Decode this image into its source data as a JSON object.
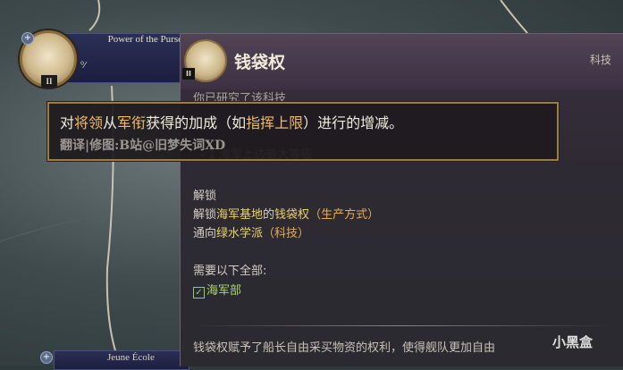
{
  "left_card": {
    "title": "Power of the Purse",
    "roman": "II",
    "small": "⁰⁄"
  },
  "bottom_card": {
    "title": "Jeune École"
  },
  "panel": {
    "title": "钱袋权",
    "category": "科技",
    "roman": "II",
    "research_line": "你已研究了该科技",
    "effect_line": "- 1 海军上边最大等级",
    "unlock_header": "解锁",
    "unlock_1_prefix": "解锁",
    "unlock_1_place": "海军基地",
    "unlock_1_mid": "的",
    "unlock_1_item": "钱袋权",
    "unlock_1_type": "（生产方式）",
    "unlock_2_prefix": "通向",
    "unlock_2_item": "绿水学派",
    "unlock_2_type": "（科技）",
    "req_header": "需要以下全部:",
    "req_item": "海军部",
    "footer": "钱袋权赋予了船长自由采买物资的权利，使得舰队更加自由"
  },
  "overlay": {
    "p1": "对",
    "h1": "将领",
    "p2": "从",
    "h2": "军衔",
    "p3": "获得的加成（如",
    "h3": "指挥上限",
    "p4": "）进行的增减。",
    "credit": "翻译|修图:B站@旧梦失词XD"
  },
  "watermark": "小黑盒"
}
